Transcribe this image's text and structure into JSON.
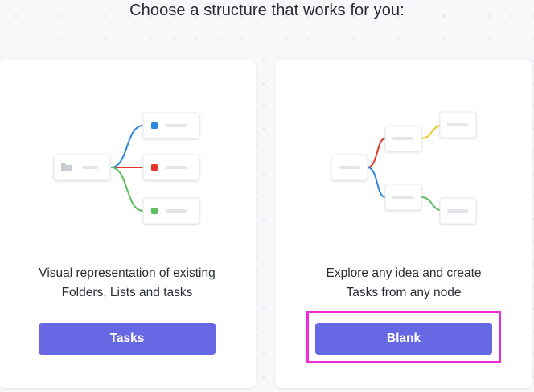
{
  "heading": "Choose a structure that works for you:",
  "options": [
    {
      "description_lines": [
        "Visual representation of existing",
        "Folders, Lists and tasks"
      ],
      "button_label": "Tasks"
    },
    {
      "description_lines": [
        "Explore any idea and create",
        "Tasks from any node"
      ],
      "button_label": "Blank"
    }
  ],
  "colors": {
    "button": "#6669e3",
    "highlight": "#ee2bd6",
    "blue": "#2f86de",
    "red": "#e5352b",
    "green": "#5cbf5f",
    "yellow": "#f2c21f"
  },
  "icons": {
    "folder": "folder-icon"
  }
}
